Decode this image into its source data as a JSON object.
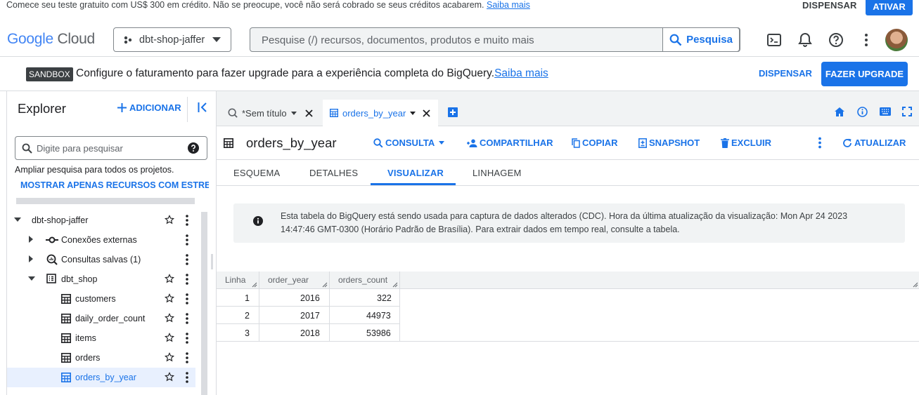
{
  "promo": {
    "text": "Comece seu teste gratuito com US$ 300 em crédito. Não se preocupe, você não será cobrado se seus créditos acabarem.",
    "link": "Saiba mais",
    "dismiss": "DISPENSAR",
    "activate": "ATIVAR"
  },
  "header": {
    "logo_google": "Google",
    "logo_cloud": "Cloud",
    "project": "dbt-shop-jaffer",
    "search_placeholder": "Pesquise (/) recursos, documentos, produtos e muito mais",
    "search_button": "Pesquisa"
  },
  "sandbox": {
    "badge": "SANDBOX",
    "text": "Configure o faturamento para fazer upgrade para a experiência completa do BigQuery.",
    "link": "Saiba mais",
    "dismiss": "DISPENSAR",
    "upgrade": "FAZER UPGRADE"
  },
  "explorer": {
    "title": "Explorer",
    "add": "ADICIONAR",
    "search_placeholder": "Digite para pesquisar",
    "hint": "Ampliar pesquisa para todos os projetos.",
    "starred_only": "MOSTRAR APENAS RECURSOS COM ESTRELA",
    "tree": [
      {
        "label": "dbt-shop-jaffer"
      },
      {
        "label": "Conexões externas"
      },
      {
        "label": "Consultas salvas (1)"
      },
      {
        "label": "dbt_shop"
      },
      {
        "label": "customers"
      },
      {
        "label": "daily_order_count"
      },
      {
        "label": "items"
      },
      {
        "label": "orders"
      },
      {
        "label": "orders_by_year"
      }
    ]
  },
  "tabs": [
    {
      "label": "*Sem título"
    },
    {
      "label": "orders_by_year"
    }
  ],
  "detail": {
    "title": "orders_by_year",
    "actions": {
      "query": "CONSULTA",
      "share": "COMPARTILHAR",
      "copy": "COPIAR",
      "snapshot": "SNAPSHOT",
      "delete": "EXCLUIR",
      "refresh": "ATUALIZAR"
    }
  },
  "subtabs": [
    "ESQUEMA",
    "DETALHES",
    "VISUALIZAR",
    "LINHAGEM"
  ],
  "notice": {
    "line1": "Esta tabela do BigQuery está sendo usada para captura de dados alterados (CDC). Hora da última atualização da visualização: Mon Apr 24 2023",
    "line2": "14:47:46 GMT-0300 (Horário Padrão de Brasília). Para extrair dados em tempo real, consulte a tabela."
  },
  "table": {
    "headers": [
      "Linha",
      "order_year",
      "orders_count"
    ],
    "rows": [
      [
        "1",
        "2016",
        "322"
      ],
      [
        "2",
        "2017",
        "44973"
      ],
      [
        "3",
        "2018",
        "53986"
      ]
    ]
  },
  "colors": {
    "accent": "#1a73e8",
    "selected_bg": "#e8f0fe",
    "panel_bg": "#f1f3f4"
  }
}
